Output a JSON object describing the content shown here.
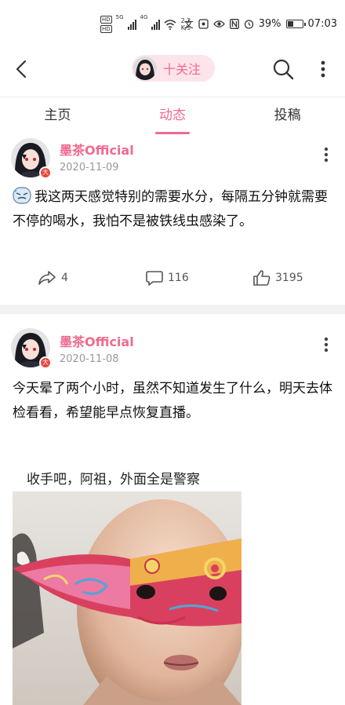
{
  "status_bar": {
    "hd1": "HD",
    "hd2": "HD",
    "signal1_label": "5G",
    "signal2_label": "4G",
    "speed_value": "2.2",
    "speed_unit": "K/s",
    "battery": "39%",
    "battery_level": 0.39,
    "time": "07:03"
  },
  "nav": {
    "follow_label": "十关注"
  },
  "tabs": [
    {
      "label": "主页"
    },
    {
      "label": "动态"
    },
    {
      "label": "投稿"
    }
  ],
  "posts": [
    {
      "author": "墨茶Official",
      "date": "2020-11-09",
      "badge": "大",
      "text": "我这两天感觉特别的需要水分，每隔五分钟就需要不停的喝水，我怕不是被铁线虫感染了。",
      "shares": "4",
      "comments": "116",
      "likes": "3195"
    },
    {
      "author": "墨茶Official",
      "date": "2020-11-08",
      "badge": "大",
      "text": "今天晕了两个小时，虽然不知道发生了什么，明天去体检看看，希望能早点恢复直播。",
      "image_caption": "收手吧，阿祖，外面全是警察"
    }
  ],
  "colors": {
    "accent": "#f06a8f",
    "pill_bg": "#fde4ea",
    "badge": "#e8453c"
  }
}
